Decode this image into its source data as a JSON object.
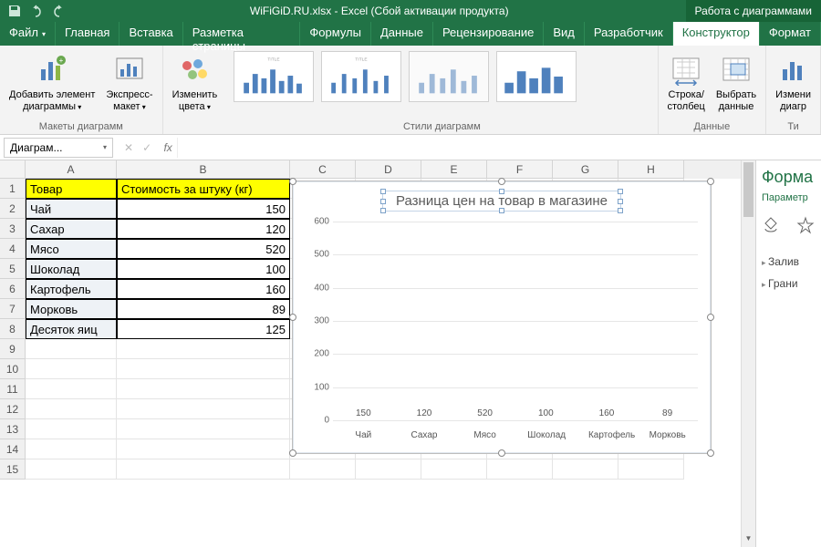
{
  "titlebar": {
    "filename": "WiFiGiD.RU.xlsx - Excel (Сбой активации продукта)",
    "context_tab": "Работа с диаграммами"
  },
  "tabs": {
    "file": "Файл",
    "home": "Главная",
    "insert": "Вставка",
    "pagelayout": "Разметка страницы",
    "formulas": "Формулы",
    "data": "Данные",
    "review": "Рецензирование",
    "view": "Вид",
    "developer": "Разработчик",
    "design": "Конструктор",
    "format": "Формат"
  },
  "ribbon": {
    "add_element": "Добавить элемент\nдиаграммы",
    "quick_layout": "Экспресс-\nмакет",
    "group_layouts": "Макеты диаграмм",
    "change_colors": "Изменить\nцвета",
    "group_styles": "Стили диаграмм",
    "switch_rc": "Строка/\nстолбец",
    "select_data": "Выбрать\nданные",
    "group_data": "Данные",
    "change_type": "Измени\nдиагр",
    "group_type": "Ти"
  },
  "namebox": {
    "value": "Диаграм..."
  },
  "sheet": {
    "col_headers": [
      "A",
      "B",
      "C",
      "D",
      "E",
      "F",
      "G",
      "H"
    ],
    "row_headers": [
      "1",
      "2",
      "3",
      "4",
      "5",
      "6",
      "7",
      "8",
      "9",
      "10",
      "11",
      "12",
      "13",
      "14",
      "15"
    ],
    "header_a": "Товар",
    "header_b": "Стоимость за штуку (кг)",
    "rows": [
      {
        "a": "Чай",
        "b": "150"
      },
      {
        "a": "Сахар",
        "b": "120"
      },
      {
        "a": "Мясо",
        "b": "520"
      },
      {
        "a": "Шоколад",
        "b": "100"
      },
      {
        "a": "Картофель",
        "b": "160"
      },
      {
        "a": "Морковь",
        "b": "89"
      },
      {
        "a": "Десяток яиц",
        "b": "125"
      }
    ]
  },
  "chart_data": {
    "type": "bar",
    "title": "Разница цен на товар в магазине",
    "categories": [
      "Чай",
      "Сахар",
      "Мясо",
      "Шоколад",
      "Картофель",
      "Морковь"
    ],
    "values": [
      150,
      120,
      520,
      100,
      160,
      89
    ],
    "ylim": [
      0,
      600
    ],
    "ystep": 100,
    "xlabel": "",
    "ylabel": ""
  },
  "sidepane": {
    "title": "Форма",
    "subtitle": "Параметр",
    "section_fill": "Залив",
    "section_border": "Грани"
  }
}
